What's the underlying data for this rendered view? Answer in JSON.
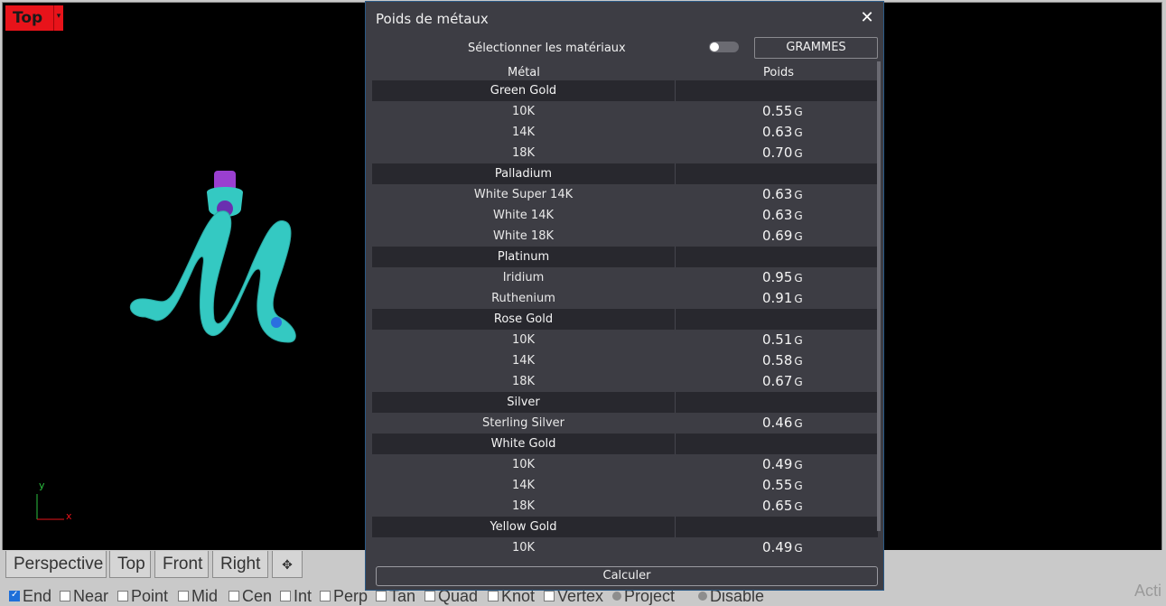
{
  "viewport": {
    "label": "Top",
    "dropdown_glyph": "▾"
  },
  "axes": {
    "y": "y",
    "x": "x"
  },
  "tabs": [
    "Perspective",
    "Top",
    "Front",
    "Right"
  ],
  "tab_add_glyph": "✥",
  "osnaps": [
    {
      "label": "End",
      "checked": true
    },
    {
      "label": "Near",
      "checked": false
    },
    {
      "label": "Point",
      "checked": false
    },
    {
      "label": "Mid",
      "checked": false
    },
    {
      "label": "Cen",
      "checked": false
    },
    {
      "label": "Int",
      "checked": false
    },
    {
      "label": "Perp",
      "checked": false
    },
    {
      "label": "Tan",
      "checked": false
    },
    {
      "label": "Quad",
      "checked": false
    },
    {
      "label": "Knot",
      "checked": false
    },
    {
      "label": "Vertex",
      "checked": false
    },
    {
      "label": "Project",
      "checked": false
    },
    {
      "label": "Disable",
      "checked": false
    }
  ],
  "watermark": "Acti",
  "dialog": {
    "title": "Poids de métaux",
    "close_glyph": "✕",
    "select_label": "Sélectionner les matériaux",
    "toggle_on": false,
    "unit_button": "GRAMMES",
    "col_metal": "Métal",
    "col_weight": "Poids",
    "unit": "G",
    "calc_button": "Calculer",
    "rows": [
      {
        "type": "group",
        "name": "Green Gold"
      },
      {
        "type": "item",
        "name": "10K",
        "value": "0.55"
      },
      {
        "type": "item",
        "name": "14K",
        "value": "0.63"
      },
      {
        "type": "item",
        "name": "18K",
        "value": "0.70"
      },
      {
        "type": "group",
        "name": "Palladium"
      },
      {
        "type": "item",
        "name": "White Super 14K",
        "value": "0.63"
      },
      {
        "type": "item",
        "name": "White 14K",
        "value": "0.63"
      },
      {
        "type": "item",
        "name": "White 18K",
        "value": "0.69"
      },
      {
        "type": "group",
        "name": "Platinum"
      },
      {
        "type": "item",
        "name": "Iridium",
        "value": "0.95"
      },
      {
        "type": "item",
        "name": "Ruthenium",
        "value": "0.91"
      },
      {
        "type": "group",
        "name": "Rose Gold"
      },
      {
        "type": "item",
        "name": "10K",
        "value": "0.51"
      },
      {
        "type": "item",
        "name": "14K",
        "value": "0.58"
      },
      {
        "type": "item",
        "name": "18K",
        "value": "0.67"
      },
      {
        "type": "group",
        "name": "Silver"
      },
      {
        "type": "item",
        "name": "Sterling Silver",
        "value": "0.46"
      },
      {
        "type": "group",
        "name": "White Gold"
      },
      {
        "type": "item",
        "name": "10K",
        "value": "0.49"
      },
      {
        "type": "item",
        "name": "14K",
        "value": "0.55"
      },
      {
        "type": "item",
        "name": "18K",
        "value": "0.65"
      },
      {
        "type": "group",
        "name": "Yellow Gold"
      },
      {
        "type": "item",
        "name": "10K",
        "value": "0.49"
      }
    ]
  },
  "colors": {
    "viewport_label_bg": "#e8131a",
    "model_fill": "#34c9c2",
    "bail_fill": "#9a3fd0",
    "dialog_bg": "#3d3d44",
    "group_row_bg": "#28282e"
  }
}
